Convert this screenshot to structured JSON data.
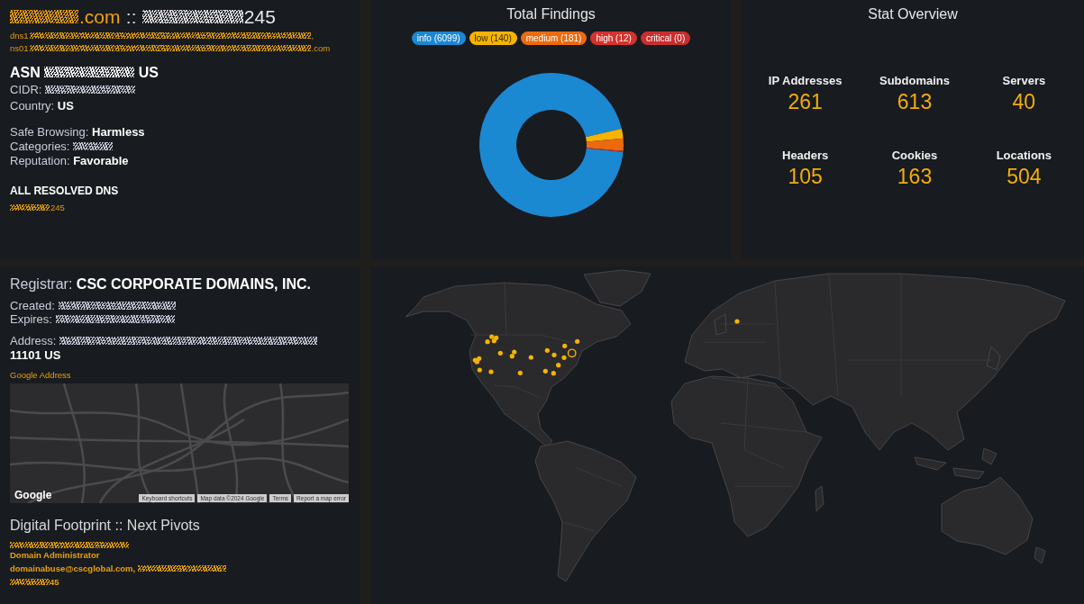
{
  "summary": {
    "title": {
      "domain": [
        {
          "kind": "redacted"
        },
        {
          "kind": "text",
          "text": ".com"
        }
      ],
      "separator": "::",
      "address": [
        {
          "kind": "redacted"
        },
        {
          "kind": "text",
          "text": "245"
        }
      ]
    },
    "name_servers": [
      [
        {
          "kind": "text",
          "text": "dns1"
        },
        {
          "kind": "redacted"
        },
        {
          "kind": "text",
          "text": ","
        }
      ],
      [
        {
          "kind": "text",
          "text": "ns01"
        },
        {
          "kind": "redacted"
        },
        {
          "kind": "text",
          "text": ".com"
        }
      ]
    ],
    "asn": [
      {
        "kind": "text",
        "text": "ASN"
      },
      {
        "kind": "redacted"
      },
      {
        "kind": "text",
        "text": "US"
      }
    ],
    "network": [
      [
        {
          "kind": "label",
          "text": "CIDR:"
        },
        {
          "kind": "redacted"
        }
      ],
      [
        {
          "kind": "label",
          "text": "Country:"
        },
        {
          "kind": "value",
          "text": "US"
        }
      ]
    ],
    "reputation": [
      [
        {
          "kind": "label",
          "text": "Safe Browsing:"
        },
        {
          "kind": "value",
          "text": "Harmless"
        }
      ],
      [
        {
          "kind": "label",
          "text": "Categories:"
        },
        {
          "kind": "redacted"
        }
      ],
      [
        {
          "kind": "label",
          "text": "Reputation:"
        },
        {
          "kind": "value",
          "text": "Favorable"
        }
      ]
    ],
    "resolved_dns": {
      "heading": "ALL RESOLVED DNS",
      "entries": [
        [
          {
            "kind": "redacted"
          },
          {
            "kind": "text",
            "text": "245"
          }
        ]
      ]
    }
  },
  "findings": {
    "chart_data": {
      "type": "donut",
      "title": "Total Findings",
      "values": [
        94.82,
        2.18,
        2.81,
        0.19,
        0
      ]
    },
    "legend": [
      {
        "label": "info (6099)",
        "color": "#1b88d2"
      },
      {
        "label": "low (140)",
        "color": "#f5b400"
      },
      {
        "label": "medium (181)",
        "color": "#eb6a0f"
      },
      {
        "label": "high (12)",
        "color": "#d4322e"
      },
      {
        "label": "critical (0)",
        "color": "#c92d2d"
      }
    ]
  },
  "stats": {
    "title": "Stat Overview",
    "items": [
      {
        "label": "IP Addresses",
        "value": "261"
      },
      {
        "label": "Subdomains",
        "value": "613"
      },
      {
        "label": "Servers",
        "value": "40"
      },
      {
        "label": "Headers",
        "value": "105"
      },
      {
        "label": "Cookies",
        "value": "163"
      },
      {
        "label": "Locations",
        "value": "504"
      }
    ]
  },
  "registration": {
    "registrar": [
      {
        "kind": "label",
        "text": "Registrar:"
      },
      {
        "kind": "value",
        "text": "CSC CORPORATE DOMAINS, INC."
      }
    ],
    "dates": [
      [
        {
          "kind": "label",
          "text": "Created:"
        },
        {
          "kind": "redacted"
        }
      ],
      [
        {
          "kind": "label",
          "text": "Expires:"
        },
        {
          "kind": "redacted"
        }
      ]
    ],
    "address": [
      {
        "kind": "label",
        "text": "Address:"
      },
      {
        "kind": "redacted"
      },
      {
        "kind": "value",
        "text": "11101 US"
      }
    ],
    "map_link": "Google Address",
    "map": {
      "logo": "Google",
      "attribution": [
        "Keyboard shortcuts",
        "Map data ©2024 Google",
        "Terms",
        "Report a map error"
      ]
    }
  },
  "footprint": {
    "title": "Digital Footprint :: Next Pivots",
    "lines": [
      [
        {
          "kind": "redacted"
        }
      ],
      [
        {
          "kind": "text",
          "text": "Domain Administrator"
        }
      ],
      [
        {
          "kind": "text",
          "text": "domainabuse@cscglobal.com,"
        },
        {
          "kind": "redacted"
        }
      ],
      [
        {
          "kind": "redacted"
        },
        {
          "kind": "text",
          "text": "45"
        }
      ]
    ]
  }
}
